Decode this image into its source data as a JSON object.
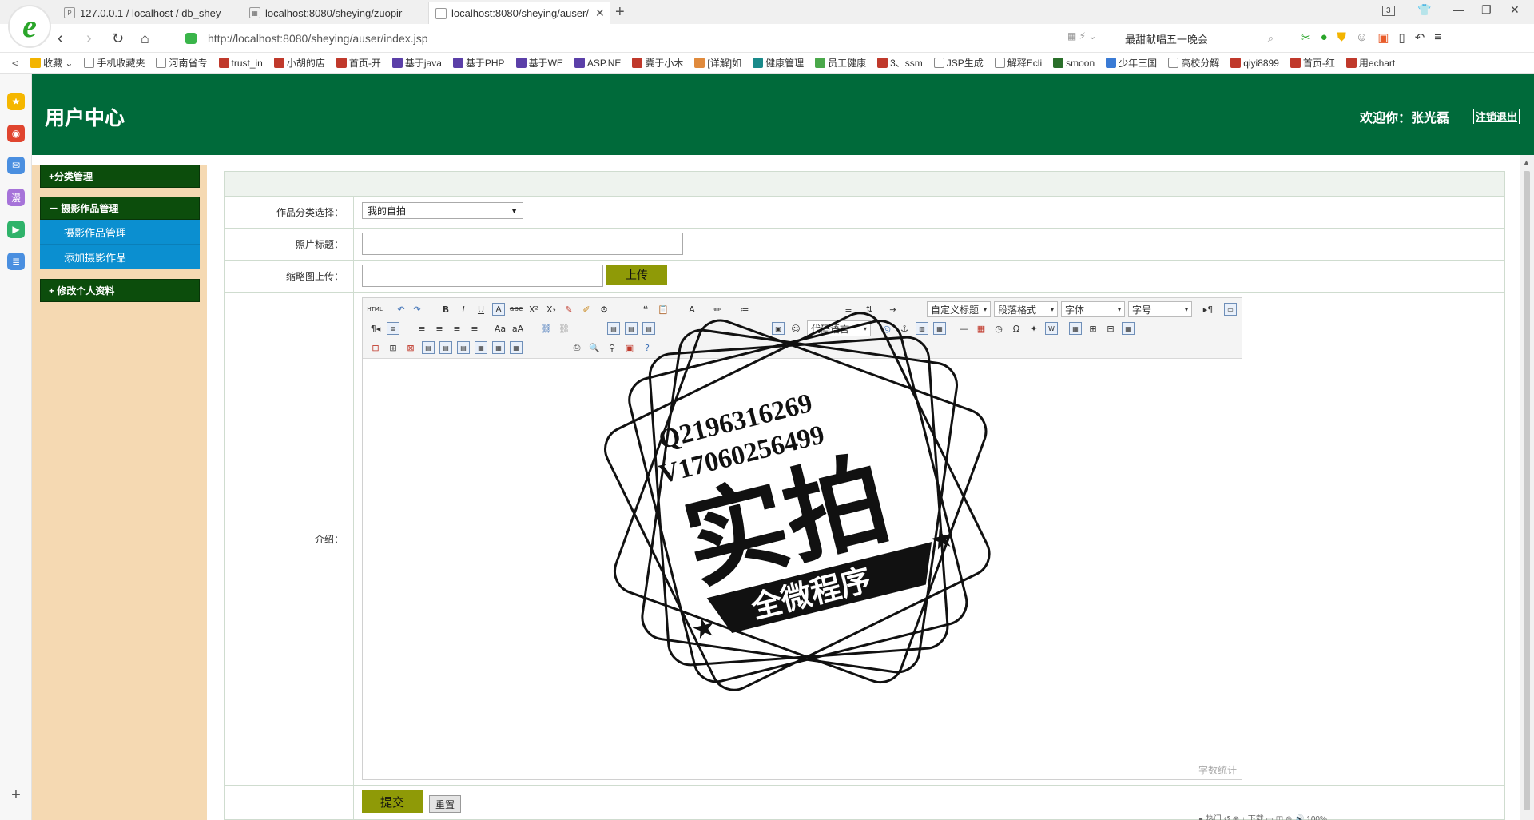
{
  "browser": {
    "tabs": [
      {
        "label": "127.0.0.1 / localhost / db_shey",
        "active": false
      },
      {
        "label": "localhost:8080/sheying/zuopir",
        "active": false
      },
      {
        "label": "localhost:8080/sheying/auser/",
        "active": true
      }
    ],
    "tab_count": "3",
    "url_host": "http://localhost",
    "url_rest": ":8080/sheying/auser/index.jsp",
    "search_text": "最甜献唱五一晚会",
    "bookmarks": [
      "收藏",
      "手机收藏夹",
      "河南省专",
      "trust_in",
      "小胡的店",
      "首页-开",
      "基于java",
      "基于PHP",
      "基于WE",
      "ASP.NE",
      "冀于小木",
      "[详解]如",
      "健康管理",
      "员工健康",
      "3、ssm",
      "JSP生成",
      "解释Ecli",
      "smoon",
      "少年三国",
      "高校分解",
      "qiyi8899",
      "首页-红",
      "用echart"
    ]
  },
  "header": {
    "title": "用户中心",
    "welcome": "欢迎你：张光磊",
    "logout": "注销退出"
  },
  "menu": {
    "group1": "+分类管理",
    "group2": "－ 摄影作品管理",
    "group2_items": [
      "摄影作品管理",
      "添加摄影作品"
    ],
    "group3": "+ 修改个人资料"
  },
  "form": {
    "category_label": "作品分类选择：",
    "category_value": "我的自拍",
    "title_label": "照片标题：",
    "thumb_label": "缩略图上传：",
    "upload_btn": "上传",
    "intro_label": "介绍：",
    "editor_combos": [
      "自定义标题",
      "段落格式",
      "字体",
      "字号",
      "代码语言"
    ],
    "word_count": "字数统计",
    "submit": "提交",
    "reset": "重置"
  },
  "watermark": {
    "line1": "Q2196316269",
    "line2": "V17060256499",
    "main": "实拍",
    "ribbon": "全微程序"
  }
}
